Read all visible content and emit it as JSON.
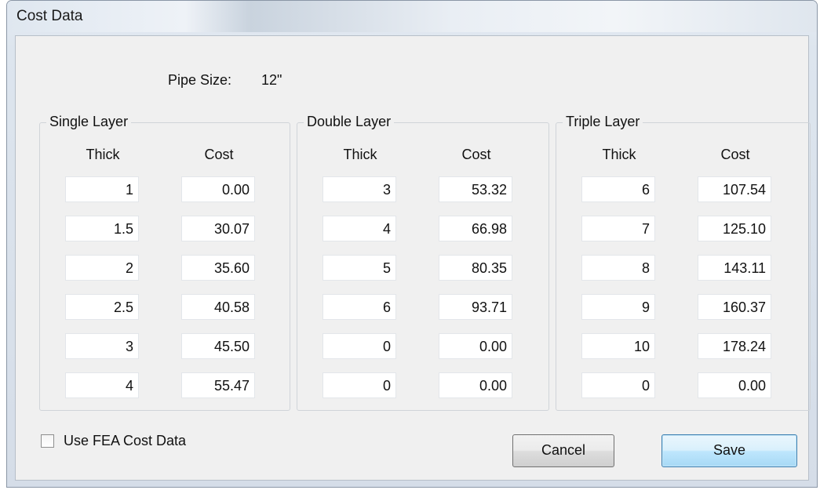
{
  "window": {
    "title": "Cost Data"
  },
  "pipe": {
    "label": "Pipe Size:",
    "value": "12\""
  },
  "columns": {
    "thick": "Thick",
    "cost": "Cost"
  },
  "groups": {
    "single": {
      "title": "Single Layer",
      "rows": [
        {
          "thick": "1",
          "cost": "0.00"
        },
        {
          "thick": "1.5",
          "cost": "30.07"
        },
        {
          "thick": "2",
          "cost": "35.60"
        },
        {
          "thick": "2.5",
          "cost": "40.58"
        },
        {
          "thick": "3",
          "cost": "45.50"
        },
        {
          "thick": "4",
          "cost": "55.47"
        }
      ]
    },
    "double": {
      "title": "Double Layer",
      "rows": [
        {
          "thick": "3",
          "cost": "53.32"
        },
        {
          "thick": "4",
          "cost": "66.98"
        },
        {
          "thick": "5",
          "cost": "80.35"
        },
        {
          "thick": "6",
          "cost": "93.71"
        },
        {
          "thick": "0",
          "cost": "0.00"
        },
        {
          "thick": "0",
          "cost": "0.00"
        }
      ]
    },
    "triple": {
      "title": "Triple Layer",
      "rows": [
        {
          "thick": "6",
          "cost": "107.54"
        },
        {
          "thick": "7",
          "cost": "125.10"
        },
        {
          "thick": "8",
          "cost": "143.11"
        },
        {
          "thick": "9",
          "cost": "160.37"
        },
        {
          "thick": "10",
          "cost": "178.24"
        },
        {
          "thick": "0",
          "cost": "0.00"
        }
      ]
    }
  },
  "options": {
    "use_fea_label": "Use FEA Cost Data",
    "use_fea_checked": false
  },
  "buttons": {
    "cancel": "Cancel",
    "save": "Save"
  }
}
